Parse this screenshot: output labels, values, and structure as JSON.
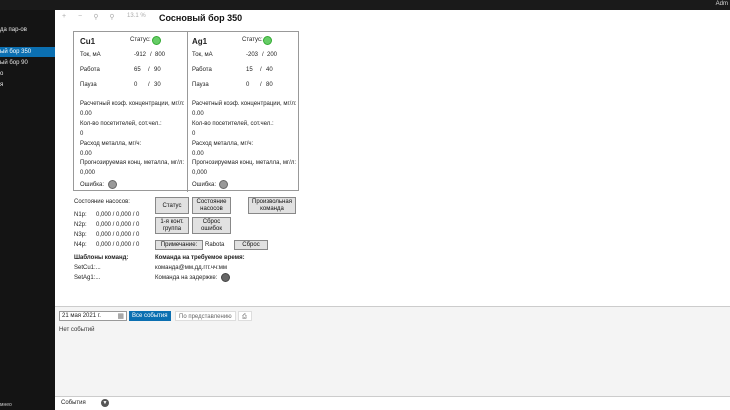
{
  "topbar": {
    "user": "Adm"
  },
  "sidebar": {
    "items": [
      "",
      "да пар-ов",
      "",
      "ый бор 350",
      "ый бор 90",
      "о",
      "я"
    ],
    "active_index": 3,
    "footer": "мнео"
  },
  "toolbar": {
    "zoom": "13.1 %"
  },
  "page_title": "Сосновый бор 350",
  "cells": [
    {
      "name": "Cu1",
      "status_label": "Статус:",
      "current_label": "Ток, мА",
      "current_value": "-912",
      "current_max": "800",
      "work_label": "Работа",
      "work_value": "65",
      "work_max": "90",
      "pause_label": "Пауза",
      "pause_value": "0",
      "pause_max": "30",
      "calc_label": "Расчетный коэф. концентрации, мг/л:",
      "calc_value": "0.00",
      "visitors_label": "Кол-во посетителей, сот.чел.:",
      "visitors_value": "0",
      "metal_label": "Расход металла, мг/ч:",
      "metal_value": "0.00",
      "forecast_label": "Прогнозируемая конц. металла, мг/л:",
      "forecast_value": "0,000",
      "error_label": "Ошибка:"
    },
    {
      "name": "Ag1",
      "status_label": "Статус:",
      "current_label": "Ток, мА",
      "current_value": "-203",
      "current_max": "200",
      "work_label": "Работа",
      "work_value": "15",
      "work_max": "40",
      "pause_label": "Пауза",
      "pause_value": "0",
      "pause_max": "80",
      "calc_label": "Расчетный коэф. концентрации, мг/л:",
      "calc_value": "0.00",
      "visitors_label": "Кол-во посетителей, сот.чел.:",
      "visitors_value": "0",
      "metal_label": "Расход металла, мг/ч:",
      "metal_value": "0.00",
      "forecast_label": "Прогнозируемая конц. металла, мг/л:",
      "forecast_value": "0,000",
      "error_label": "Ошибка:"
    }
  ],
  "pumps": {
    "title": "Состояние насосов:",
    "rows": [
      {
        "name": "N1p:",
        "value": "0,000 / 0,000 / 0"
      },
      {
        "name": "N2p:",
        "value": "0,000 / 0,000 / 0"
      },
      {
        "name": "N3p:",
        "value": "0,000 / 0,000 / 0"
      },
      {
        "name": "N4p:",
        "value": "0,000 / 0,000 / 0"
      }
    ]
  },
  "buttons": {
    "status": "Статус",
    "pump_state_1": "Состояние",
    "pump_state_2": "насосов",
    "custom_1": "Произвольная",
    "custom_2": "команда",
    "group_1": "1-я конт.",
    "group_2": "группа",
    "reset_err_1": "Сброс",
    "reset_err_2": "ошибок",
    "note": "Примечание:",
    "note_value": "Rabota",
    "reset": "Сброс"
  },
  "templates": {
    "title": "Шаблоны команд:",
    "items": [
      "SetCu1:...",
      "SetAg1:..."
    ]
  },
  "timed": {
    "title": "Команда на требуемое время:",
    "format": "команда@мм.дд.ггг.чч:мм",
    "delay_label": "Команда на задержке:"
  },
  "events": {
    "date": "21 мая 2021 г.",
    "tab_all": "Все события",
    "tab_view": "По представлению",
    "empty": "Нет событий"
  },
  "footer": {
    "label": "События"
  }
}
